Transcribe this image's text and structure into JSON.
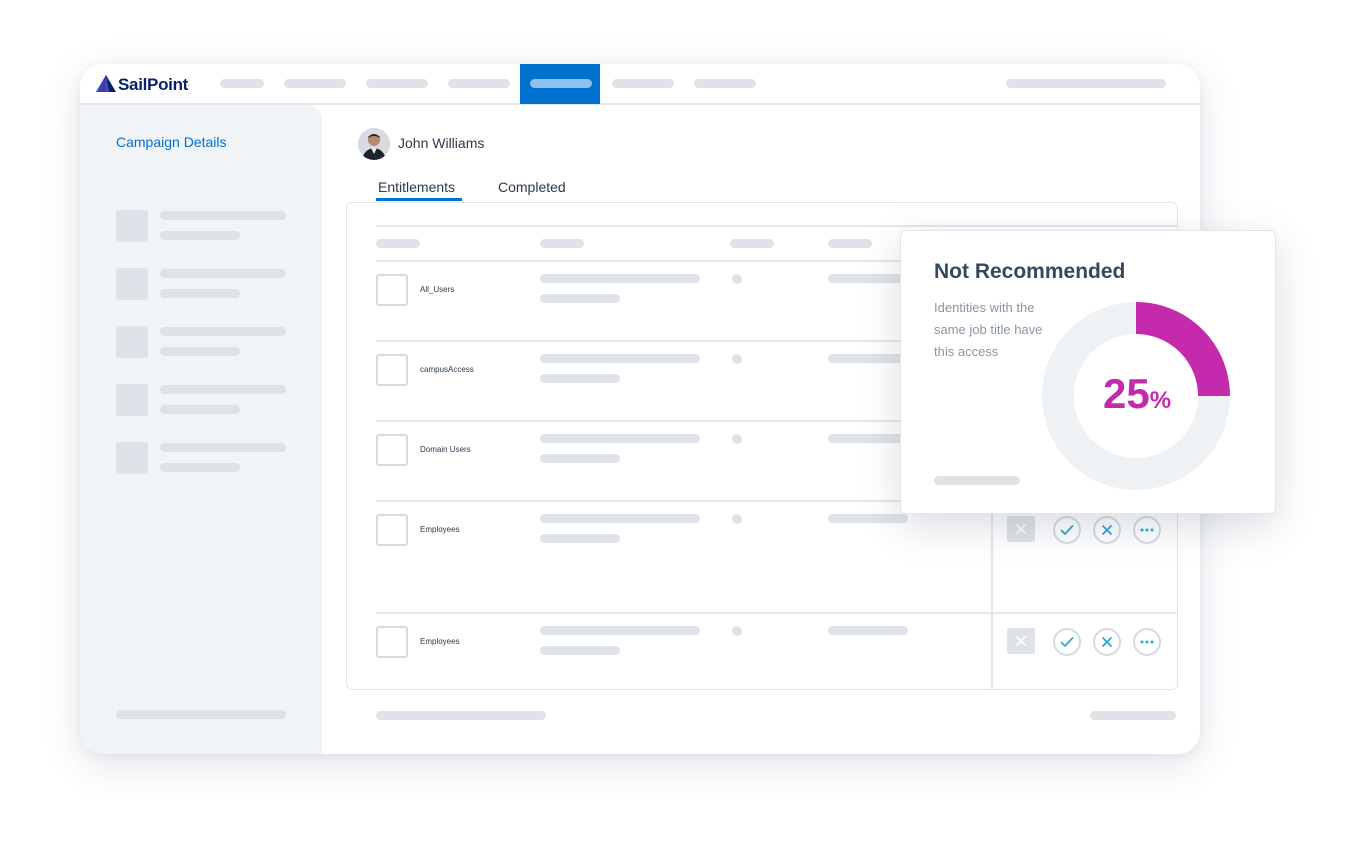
{
  "brand": {
    "name": "SailPoint",
    "trademark": ".",
    "color": "#0b1f6b",
    "accent": "#0071ce"
  },
  "sidebar": {
    "title": "Campaign Details"
  },
  "user": {
    "name": "John Williams",
    "avatar": "user-avatar"
  },
  "tabs": [
    {
      "label": "Entitlements",
      "active": true
    },
    {
      "label": "Completed",
      "active": false
    }
  ],
  "rows": [
    {
      "name": "All_Users"
    },
    {
      "name": "campusAccess"
    },
    {
      "name": "Domain Users"
    },
    {
      "name": "Employees"
    },
    {
      "name": "Employees"
    }
  ],
  "row_actions": [
    "remove-icon",
    "approve-icon",
    "revoke-icon",
    "more-icon"
  ],
  "popup": {
    "title": "Not Recommended",
    "description": "Identities with the same job title have this access",
    "percent_value": 25,
    "percent_number": "25",
    "percent_symbol": "%",
    "accent_color": "#c62aac"
  }
}
